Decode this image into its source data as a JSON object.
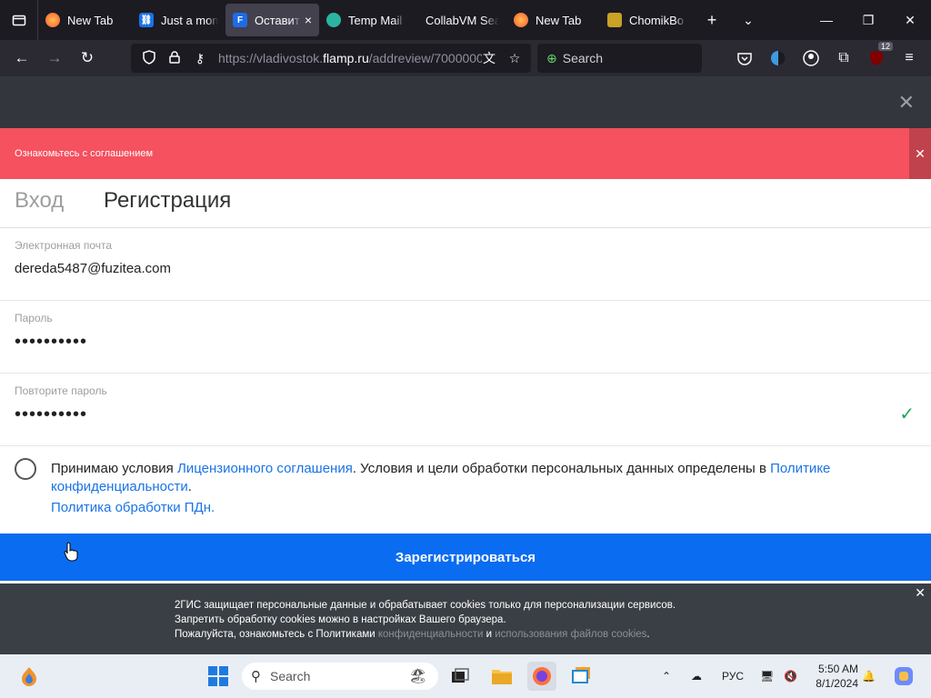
{
  "browser": {
    "tabs": [
      {
        "title": "New Tab",
        "color": "#ff7139"
      },
      {
        "title": "Just a mom",
        "color": "#1a73e8"
      },
      {
        "title": "Оставит",
        "color": "#1e6be6"
      },
      {
        "title": "Temp Mail",
        "color": "#2bb5a0"
      },
      {
        "title": "CollabVM Sear",
        "color": ""
      },
      {
        "title": "New Tab",
        "color": "#ff7139"
      },
      {
        "title": "ChomikBo",
        "color": "#c9a227"
      }
    ],
    "active_tab_close": "×",
    "url_prefix": "https://vladivostok.",
    "url_domain": "flamp.ru",
    "url_rest": "/addreview/7000000",
    "search_placeholder": "Search",
    "extension_badge": "12"
  },
  "page": {
    "alert_text": "Ознакомьтесь с соглашением",
    "tab_login": "Вход",
    "tab_register": "Регистрация",
    "email_label": "Электронная почта",
    "email_value": "dereda5487@fuzitea.com",
    "password_label": "Пароль",
    "password_value": "••••••••••",
    "repeat_label": "Повторите пароль",
    "repeat_value": "••••••••••",
    "agree_prefix": "Принимаю условия ",
    "agree_link1": "Лицензионного соглашения",
    "agree_middle": ". Условия и цели обработки персональных данных определены в ",
    "agree_link2": "Политике конфиденциальности",
    "agree_end": ".",
    "agree_link3": "Политика обработки ПДн.",
    "register_button": "Зарегистрироваться",
    "cookie_line1": "2ГИС защищает персональные данные и обрабатывает cookies только для персонализации сервисов.",
    "cookie_line2": "Запретить обработку cookies можно в настройках Вашего браузера.",
    "cookie_line3_prefix": "Пожалуйста, ознакомьтесь с Политиками ",
    "cookie_link1": "конфиденциальности",
    "cookie_and": " и ",
    "cookie_link2": "использования файлов cookies",
    "cookie_end": "."
  },
  "taskbar": {
    "search_placeholder": "Search",
    "language": "РУС",
    "time": "5:50 AM",
    "date": "8/1/2024"
  }
}
